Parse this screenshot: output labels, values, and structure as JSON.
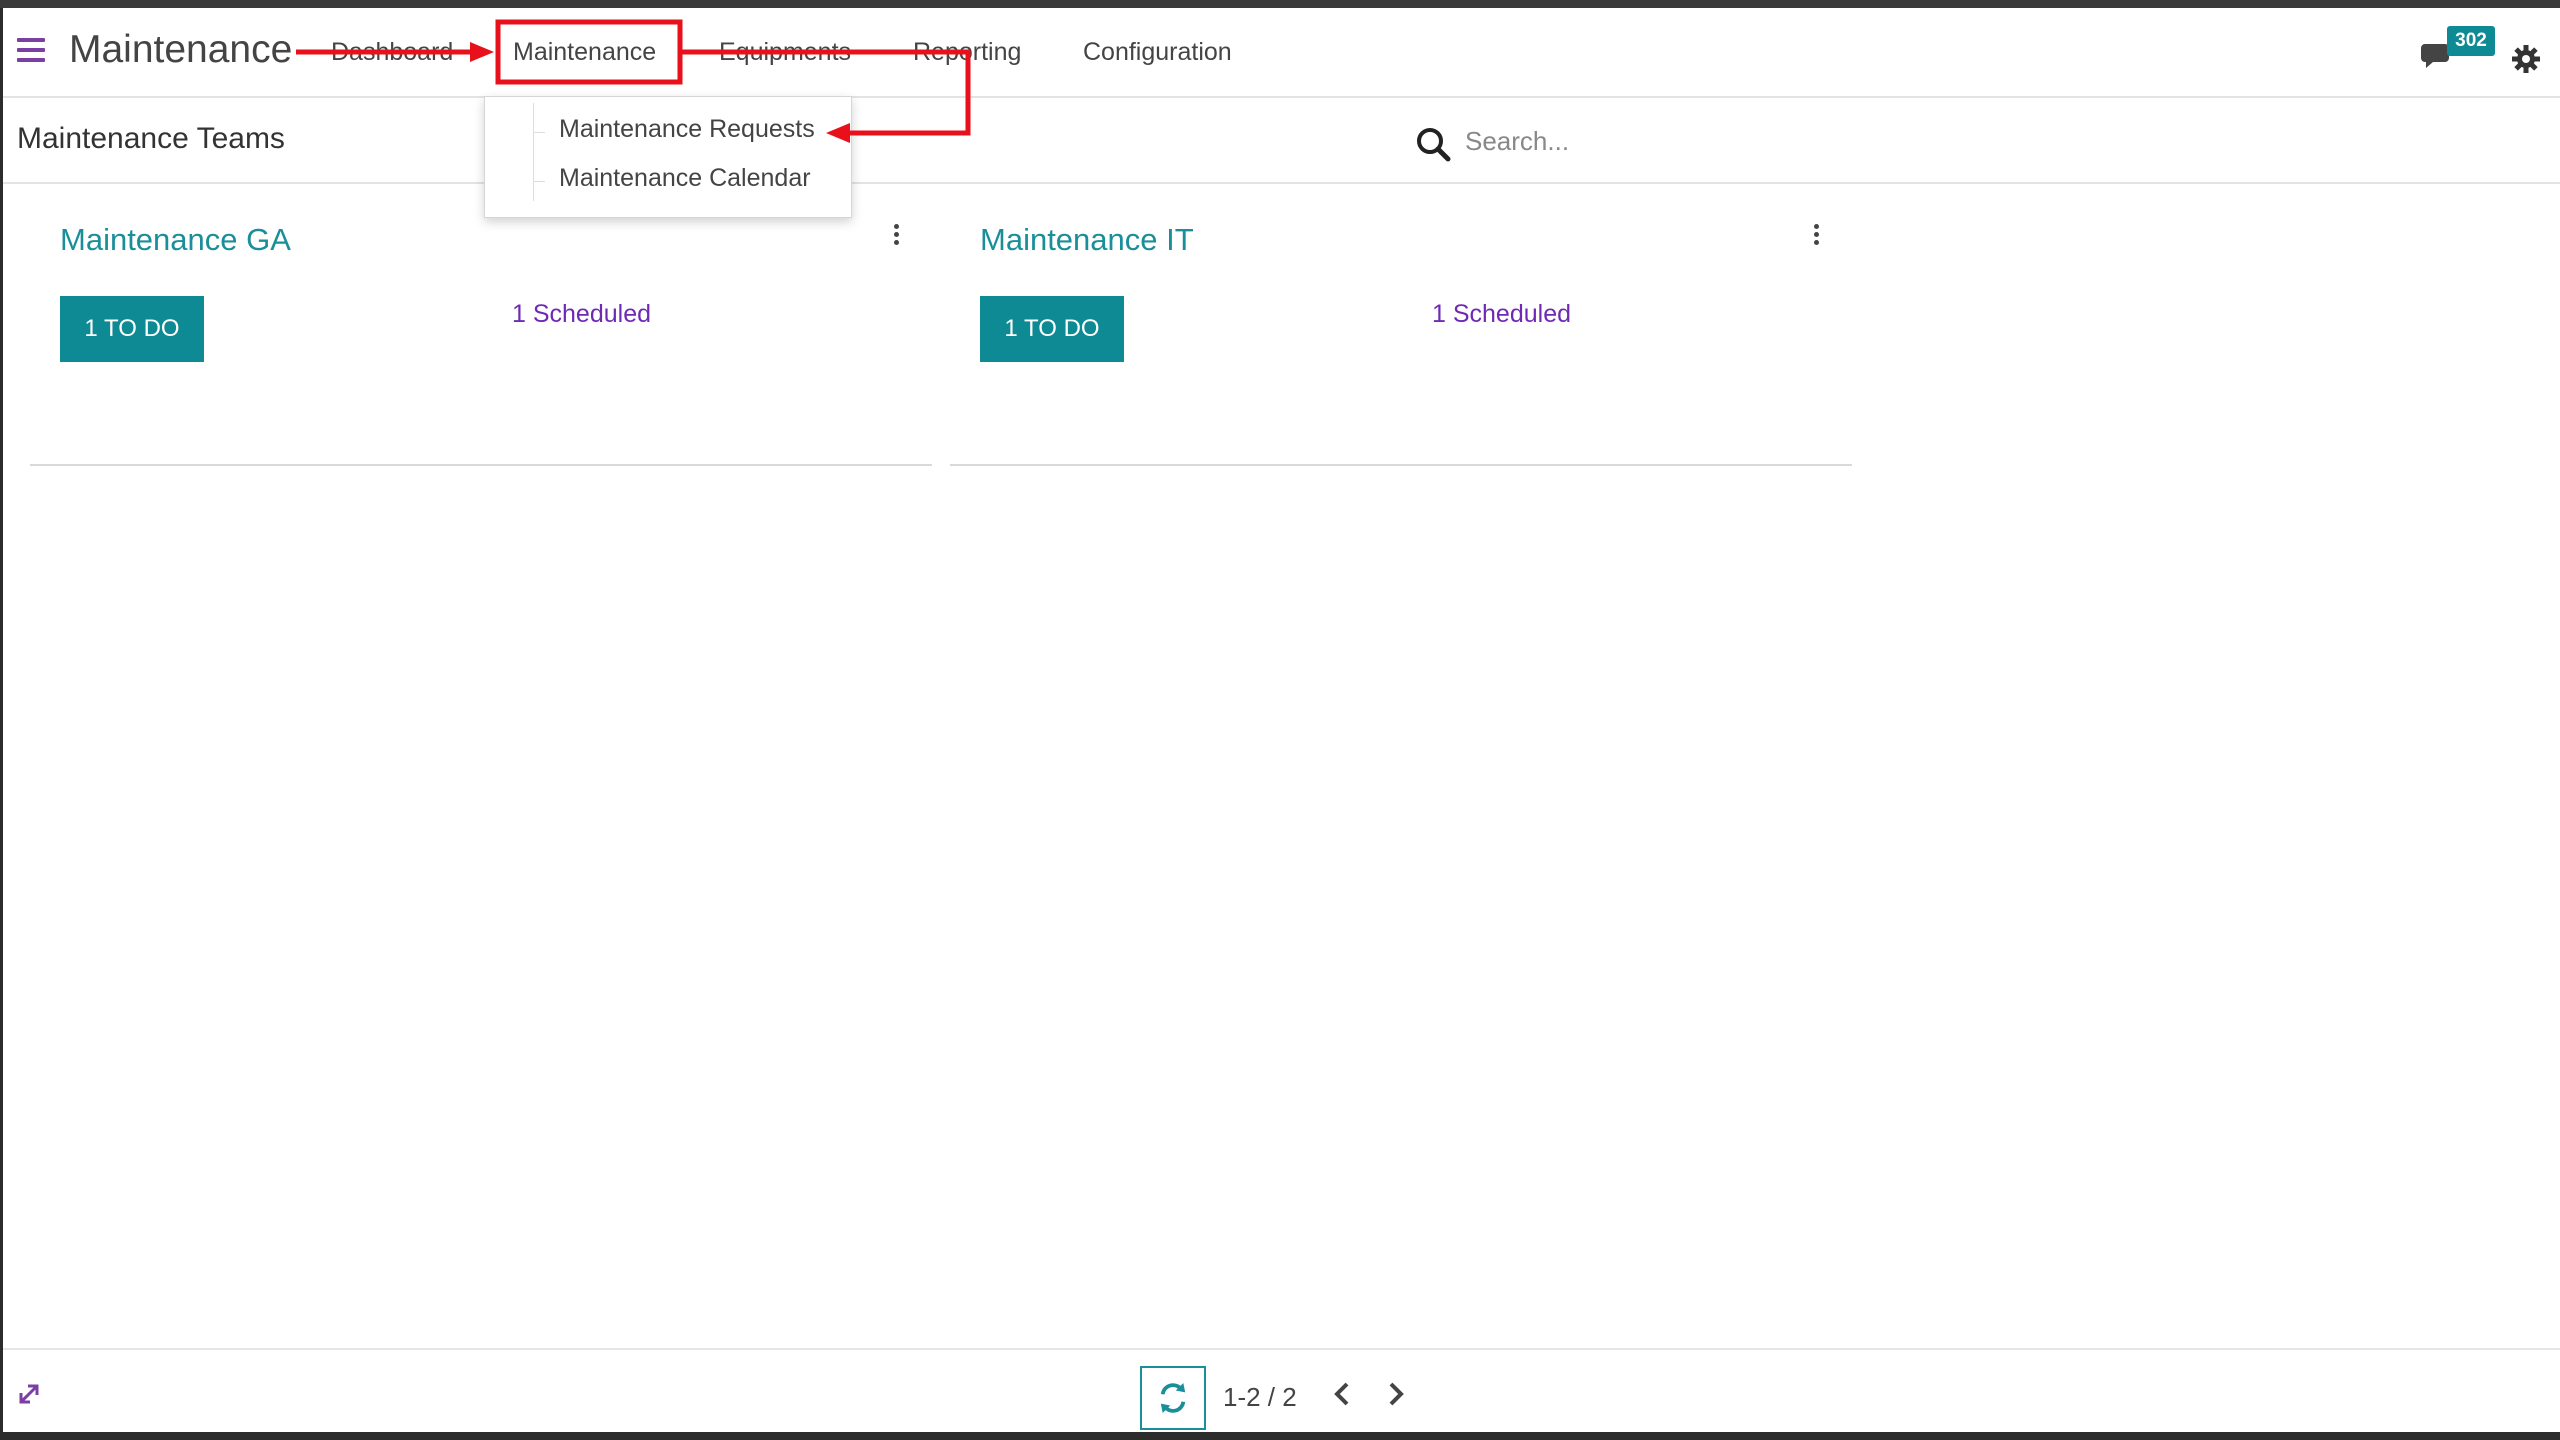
{
  "app": {
    "title": "Maintenance"
  },
  "nav": {
    "items": [
      {
        "label": "Dashboard"
      },
      {
        "label": "Maintenance"
      },
      {
        "label": "Equipments"
      },
      {
        "label": "Reporting"
      },
      {
        "label": "Configuration"
      }
    ],
    "messages_badge": "302"
  },
  "dropdown": {
    "items": [
      {
        "label": "Maintenance Requests"
      },
      {
        "label": "Maintenance Calendar"
      }
    ]
  },
  "control_panel": {
    "breadcrumb": "Maintenance Teams",
    "search_placeholder": "Search..."
  },
  "teams": [
    {
      "name": "Maintenance GA",
      "todo_label": "1 TO DO",
      "scheduled_label": "1 Scheduled"
    },
    {
      "name": "Maintenance IT",
      "todo_label": "1 TO DO",
      "scheduled_label": "1 Scheduled"
    }
  ],
  "pager": {
    "value": "1-2 / 2"
  },
  "colors": {
    "accent": "#0e8a94",
    "link_teal": "#1a8f99",
    "brand_purple": "#7b3fa3",
    "annotation_red": "#e8101a"
  },
  "icons": [
    "hamburger-icon",
    "chat-icon",
    "gear-icon",
    "search-icon",
    "kebab-menu-icon",
    "expand-icon",
    "refresh-icon",
    "chevron-left-icon",
    "chevron-right-icon"
  ]
}
